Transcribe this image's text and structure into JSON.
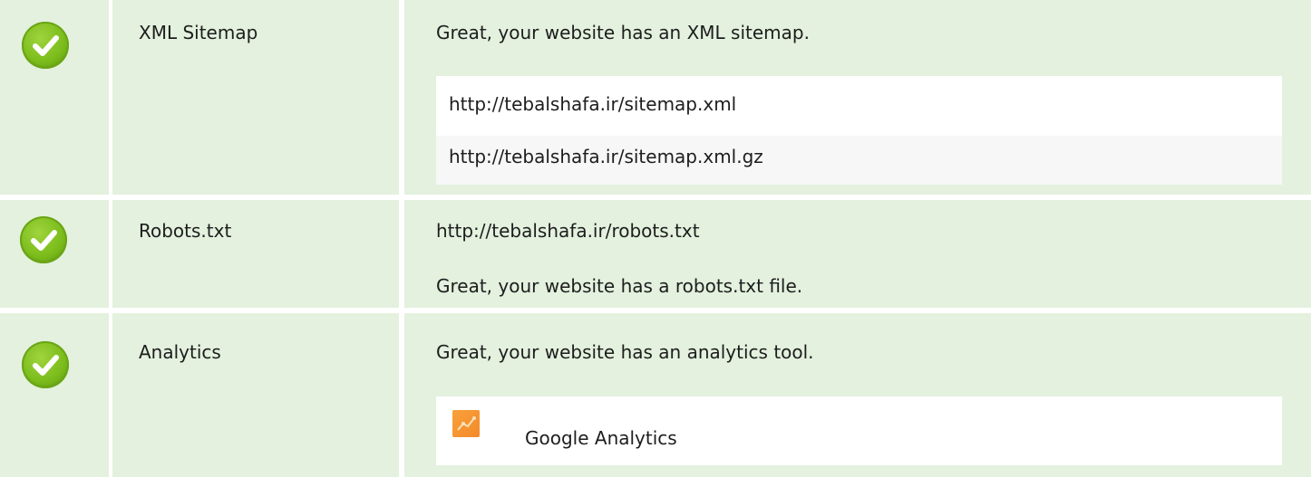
{
  "rows": [
    {
      "status_icon": "check-circle-icon",
      "label": "XML Sitemap",
      "message": "Great, your website has an XML sitemap.",
      "urls": [
        "http://tebalshafa.ir/sitemap.xml",
        "http://tebalshafa.ir/sitemap.xml.gz"
      ]
    },
    {
      "status_icon": "check-circle-icon",
      "label": "Robots.txt",
      "url": "http://tebalshafa.ir/robots.txt",
      "message": "Great, your website has a robots.txt file."
    },
    {
      "status_icon": "check-circle-icon",
      "label": "Analytics",
      "message": "Great, your website has an analytics tool.",
      "tool": {
        "icon": "google-analytics-icon",
        "name": "Google Analytics"
      }
    }
  ],
  "colors": {
    "cell_background": "#e3f1de",
    "status_good": "#7cbd1c",
    "analytics_icon": "#f48a2a"
  }
}
